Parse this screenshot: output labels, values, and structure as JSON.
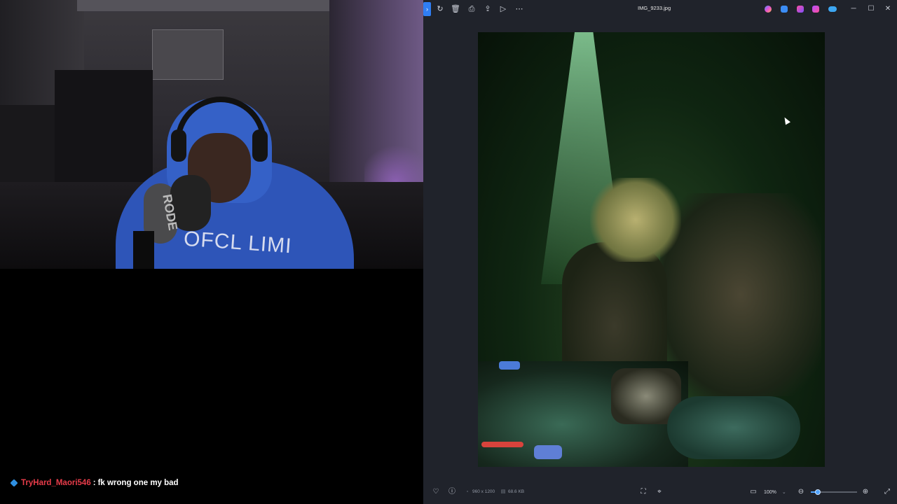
{
  "stream": {
    "webcam": {
      "hoodie_text": "OFCL LIMI",
      "mic_brand": "RODE"
    },
    "chat": {
      "messages": [
        {
          "user": "TryHard_Maori546",
          "separator": ":",
          "text": "fk wrong one my bad",
          "user_color": "#e83c4a"
        }
      ]
    }
  },
  "viewer": {
    "title": "IMG_9233.jpg",
    "toolbar_icons": [
      "rotate-icon",
      "delete-icon",
      "print-icon",
      "share-icon",
      "slideshow-icon",
      "more-icon"
    ],
    "app_icons": [
      "copilot-icon",
      "edit-icon",
      "clipchamp-icon",
      "designer-icon",
      "onedrive-icon"
    ],
    "window_controls": {
      "minimize": "─",
      "maximize": "☐",
      "close": "✕"
    },
    "footer": {
      "dimensions": "960 x 1200",
      "file_size": "68.6 KB",
      "zoom": "100%",
      "zoom_level": 0.15
    },
    "accent": "#2f7ef5"
  }
}
